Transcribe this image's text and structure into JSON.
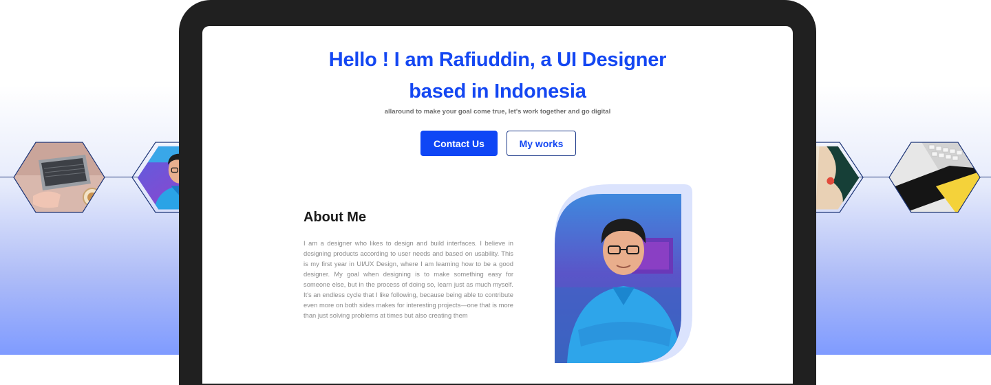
{
  "hero": {
    "title_line1": "Hello ! I am Rafiuddin, a UI Designer",
    "title_line2": "based in Indonesia",
    "subtitle": "allaround to make your goal come true, let's work together and go digital",
    "primary_button": "Contact Us",
    "secondary_button": "My works"
  },
  "about": {
    "title": "About Me",
    "body": "I am a designer who likes to design and build interfaces. I believe in designing products according to user needs and based on usability. This is my first year in UI/UX Design, where I am learning how to be a good designer. My goal when designing is to make something easy for someone else, but in the process of doing so, learn just as much myself. It's an endless cycle that I like following, because being able to contribute even more on both sides makes for interesting projects—one that is more than just solving problems at times but also creating them"
  },
  "decor": {
    "left_hexagons": [
      "laptop-coffee-photo",
      "designer-avatar-illustration"
    ],
    "right_hexagons": [
      "abstract-art-photo",
      "keyboard-desk-photo"
    ]
  },
  "colors": {
    "brand_blue": "#1447f2",
    "device_frame": "#202020",
    "body_text": "#8a8a8a"
  }
}
